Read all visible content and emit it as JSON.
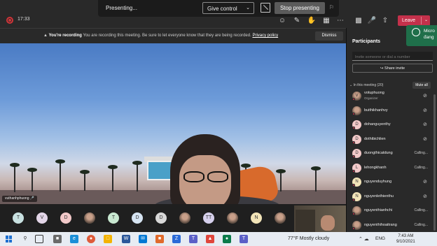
{
  "header": {
    "timer": "17:33",
    "presenting_label": "Presenting...",
    "give_control_label": "Give control",
    "stop_presenting_label": "Stop presenting",
    "leave_label": "Leave"
  },
  "banner": {
    "title": "You're recording",
    "message": "You are recording this meeting. Be sure to let everyone know that they are being recorded.",
    "policy_link": "Privacy policy",
    "dismiss_label": "Dismiss"
  },
  "video": {
    "presenter_name": "vuthanhphuong"
  },
  "thumbnails": [
    {
      "initial": "T",
      "color": "#c8e0e0"
    },
    {
      "initial": "V",
      "color": "#e3d6e8"
    },
    {
      "initial": "D",
      "color": "#f2c9c9"
    },
    {
      "initial": "",
      "color": "photo"
    },
    {
      "initial": "T",
      "color": "#c8e8d0"
    },
    {
      "initial": "D",
      "color": "#d6e4f2"
    },
    {
      "initial": "D",
      "color": "#d8d8d8"
    },
    {
      "initial": "",
      "color": "photo"
    },
    {
      "initial": "TT",
      "color": "#d6d0ec"
    },
    {
      "initial": "",
      "color": "photo"
    },
    {
      "initial": "N",
      "color": "#f2e4b8"
    },
    {
      "initial": "",
      "color": "photo"
    }
  ],
  "toast": {
    "line1": "Micro",
    "line2": "đang"
  },
  "participants_panel": {
    "title": "Participants",
    "invite_placeholder": "Invite someone or dial a number",
    "share_invite_label": "Share invite",
    "in_meeting_label": "In this meeting (20)",
    "mute_all_label": "Mute all",
    "people": [
      {
        "name": "votuphuong",
        "role": "Organizer",
        "status": "",
        "initial": "V",
        "color": "photo"
      },
      {
        "name": "buithikhanhvy",
        "role": "",
        "status": "",
        "initial": "",
        "color": "photo"
      },
      {
        "name": "dohanguyenthy",
        "role": "",
        "status": "",
        "initial": "D",
        "color": "#f2c9c9"
      },
      {
        "name": "dothibichlien",
        "role": "",
        "status": "",
        "initial": "D",
        "color": "#f2c9c9"
      },
      {
        "name": "duongthicatdung",
        "role": "",
        "status": "Calling...",
        "initial": "D",
        "color": "#f2c9c9"
      },
      {
        "name": "lehongkhanh",
        "role": "",
        "status": "Calling...",
        "initial": "L",
        "color": "#f2c9c9"
      },
      {
        "name": "nguyenduyhung",
        "role": "",
        "status": "",
        "initial": "N",
        "color": "#f2e4b8"
      },
      {
        "name": "nguyenlethienthu",
        "role": "",
        "status": "",
        "initial": "N",
        "color": "#f2e4b8"
      },
      {
        "name": "nguyenthianhchi",
        "role": "",
        "status": "Calling...",
        "initial": "",
        "color": "photo"
      },
      {
        "name": "nguyenthihoaitrang",
        "role": "",
        "status": "Calling...",
        "initial": "",
        "color": "photo"
      }
    ]
  },
  "taskbar": {
    "weather": "77°F  Mostly cloudy",
    "language": "ENG",
    "time": "7:43 AM",
    "date": "9/10/2021"
  }
}
